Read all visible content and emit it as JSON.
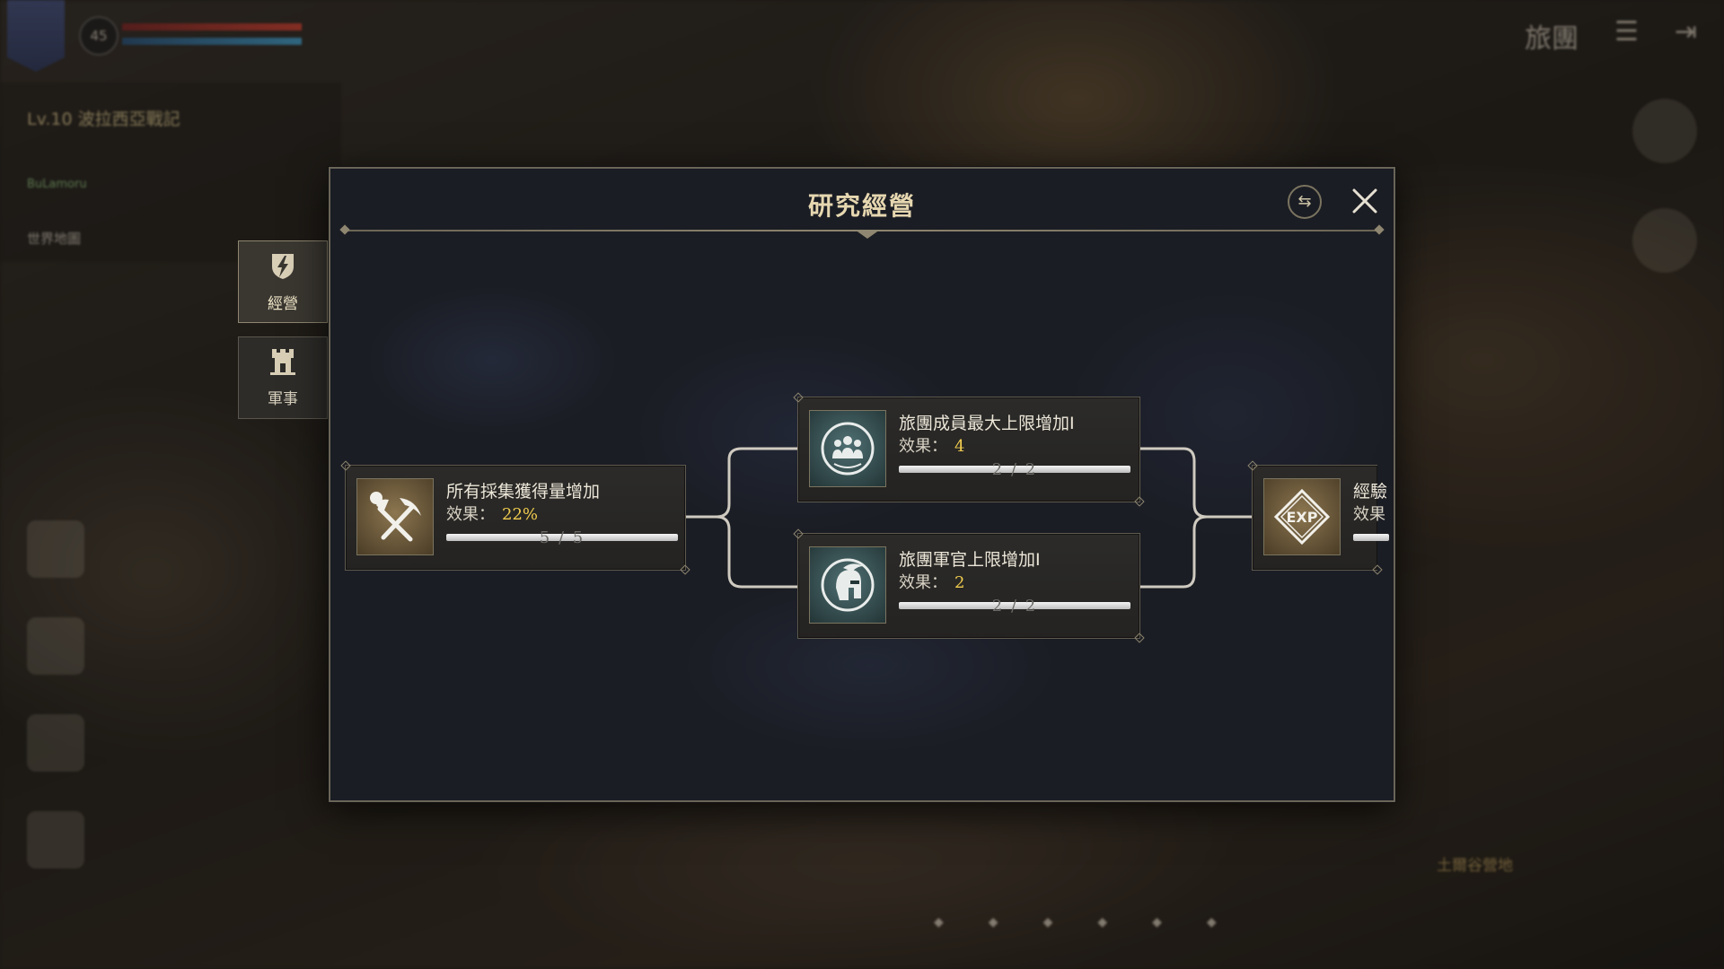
{
  "hud": {
    "level": "45",
    "quest_title": "Lv.10 波拉西亞戰記",
    "quest_sub": "BuLamoru",
    "map_label": "世界地圖",
    "top_right_label": "旅團",
    "zone_label": "土爾谷營地"
  },
  "dialog": {
    "title": "研究經營",
    "filter_icon": "signpost-icon",
    "close_icon": "close-icon"
  },
  "tabs": [
    {
      "label": "經營",
      "icon": "lightning-shield-icon",
      "active": true
    },
    {
      "label": "軍事",
      "icon": "castle-tower-icon",
      "active": false
    }
  ],
  "nodes": {
    "gather": {
      "name": "所有採集獲得量增加",
      "effect_label": "效果：",
      "effect_value": "22%",
      "count": "5 / 5",
      "progress": 1.0,
      "icon": "axe-pickaxe-icon"
    },
    "members": {
      "name": "旅團成員最大上限增加I",
      "effect_label": "效果：",
      "effect_value": "4",
      "count": "2 / 2",
      "progress": 1.0,
      "icon": "group-members-icon"
    },
    "officers": {
      "name": "旅團軍官上限增加I",
      "effect_label": "效果：",
      "effect_value": "2",
      "count": "2 / 2",
      "progress": 1.0,
      "icon": "spartan-helmet-icon"
    },
    "exp": {
      "name": "經驗",
      "effect_label": "效果",
      "icon": "exp-diamond-icon",
      "icon_text": "EXP"
    }
  }
}
